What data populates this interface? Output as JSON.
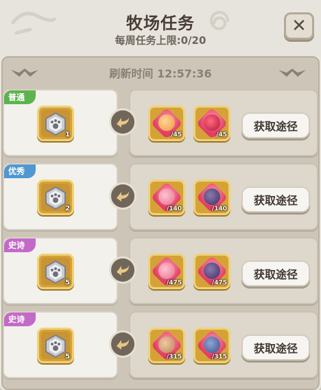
{
  "header": {
    "title": "牧场任务",
    "subtitle": "每周任务上限:0/20"
  },
  "refresh": {
    "label": "刷新时间 12:57:36"
  },
  "colors": {
    "tag_common": "#5bb44e",
    "tag_rare": "#4f98d1",
    "tag_epic": "#c36ac9",
    "slot_gold": "#d5a238",
    "gem_red": "#e23d63"
  },
  "tasks": [
    {
      "tag": "普通",
      "tag_color": "#5bb44e",
      "reward": {
        "icon": "paw-badge-icon",
        "qty": "1"
      },
      "requirements": [
        {
          "icon": "orange-creature-icon",
          "have": "",
          "need": "/45"
        },
        {
          "icon": "red-dragon-icon",
          "have": "",
          "need": "/45"
        }
      ],
      "button": "获取途径"
    },
    {
      "tag": "优秀",
      "tag_color": "#4f98d1",
      "reward": {
        "icon": "paw-badge-icon",
        "qty": "2"
      },
      "requirements": [
        {
          "icon": "pink-creature-icon",
          "have": "",
          "need": "/140"
        },
        {
          "icon": "purple-beast-icon",
          "have": "",
          "need": "/140"
        }
      ],
      "button": "获取途径"
    },
    {
      "tag": "史诗",
      "tag_color": "#c36ac9",
      "reward": {
        "icon": "paw-badge-icon",
        "qty": "5"
      },
      "requirements": [
        {
          "icon": "pink-creature-icon",
          "have": "",
          "need": "/475"
        },
        {
          "icon": "purple-beast-icon",
          "have": "",
          "need": "/475"
        }
      ],
      "button": "获取途径"
    },
    {
      "tag": "史诗",
      "tag_color": "#c36ac9",
      "reward": {
        "icon": "paw-badge-icon",
        "qty": "5"
      },
      "requirements": [
        {
          "icon": "tan-creature-icon",
          "have": "",
          "need": "/315"
        },
        {
          "icon": "blue-beast-icon",
          "have": "",
          "need": "/315"
        }
      ],
      "button": "获取途径"
    }
  ]
}
